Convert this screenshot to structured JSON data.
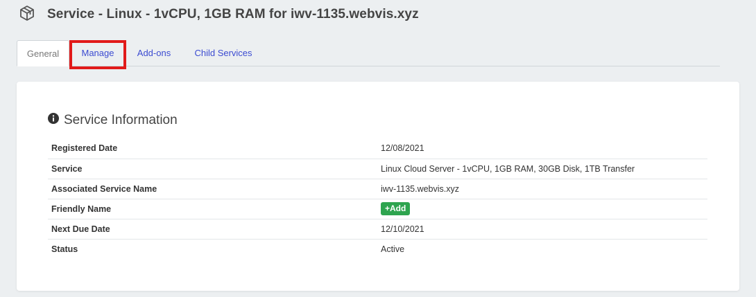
{
  "header": {
    "icon": "cube-icon",
    "title": "Service - Linux - 1vCPU, 1GB RAM for iwv-1135.webvis.xyz"
  },
  "tabs": [
    {
      "label": "General",
      "active": true
    },
    {
      "label": "Manage",
      "active": false,
      "highlighted": true
    },
    {
      "label": "Add-ons",
      "active": false
    },
    {
      "label": "Child Services",
      "active": false
    }
  ],
  "section": {
    "icon": "info-circle-icon",
    "title": "Service Information"
  },
  "rows": [
    {
      "label": "Registered Date",
      "value": "12/08/2021"
    },
    {
      "label": "Service",
      "value": "Linux Cloud Server - 1vCPU, 1GB RAM, 30GB Disk, 1TB Transfer"
    },
    {
      "label": "Associated Service Name",
      "value": "iwv-1135.webvis.xyz"
    },
    {
      "label": "Friendly Name",
      "button": "+Add"
    },
    {
      "label": "Next Due Date",
      "value": "12/10/2021"
    },
    {
      "label": "Status",
      "value": "Active"
    }
  ],
  "colors": {
    "link": "#3b4bd1",
    "highlight": "#e11a1a",
    "add_button": "#2ea44f"
  }
}
